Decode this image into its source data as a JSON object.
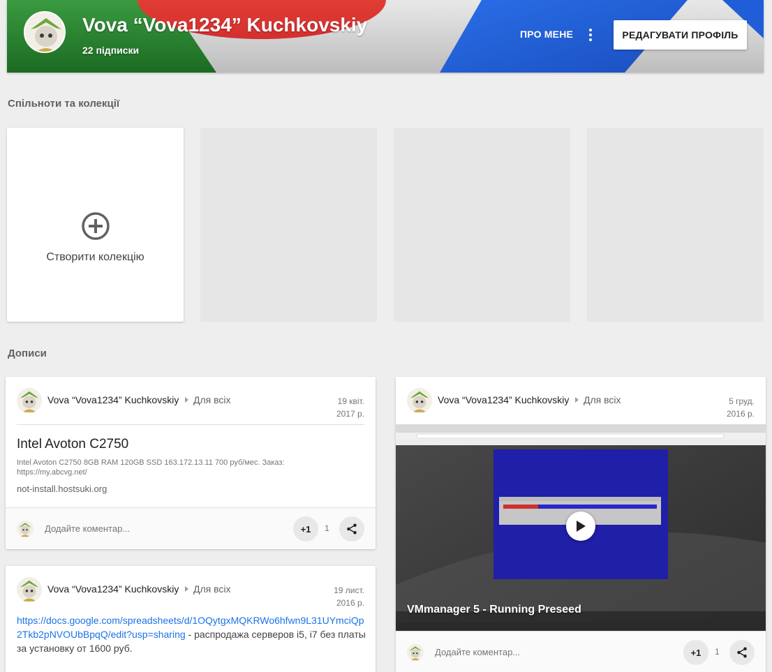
{
  "header": {
    "name": "Vova “Vova1234” Kuchkovskiy",
    "subscriptions": "22 підписки",
    "about_label": "ПРО МЕНЕ",
    "edit_label": "РЕДАГУВАТИ ПРОФІЛЬ",
    "icons": {
      "more": "more-vert-icon",
      "avatar": "avatar"
    }
  },
  "collections": {
    "section_title": "Спільноти та колекції",
    "create_label": "Створити колекцію",
    "create_icon": "add-circle-icon",
    "placeholder_count": 3
  },
  "posts_section": {
    "title": "Дописи"
  },
  "posts": [
    {
      "author": "Vova “Vova1234” Kuchkovskiy",
      "audience": "Для всіх",
      "date_line1": "19 квіт.",
      "date_line2": "2017 р.",
      "link_title": "Intel Avoton C2750",
      "link_description": "Intel Avoton C2750 8GB RAM 120GB SSD 163.172.13.11 700 руб/мес. Заказ: https://my.abcvg.net/",
      "link_domain": "not-install.hostsuki.org",
      "comment_placeholder": "Додайте коментар...",
      "plus_label": "+1",
      "plus_count": "1"
    },
    {
      "author": "Vova “Vova1234” Kuchkovskiy",
      "audience": "Для всіх",
      "date_line1": "5 груд.",
      "date_line2": "2016 р.",
      "video_title": "VMmanager 5 - Running Preseed",
      "comment_placeholder": "Додайте коментар...",
      "plus_label": "+1",
      "plus_count": "1"
    },
    {
      "author": "Vova “Vova1234” Kuchkovskiy",
      "audience": "Для всіх",
      "date_line1": "19 лист.",
      "date_line2": "2016 р.",
      "url": "https://docs.google.com/spreadsheets/d/1OQytgxMQKRWo6hfwn9L31UYmciQp2Tkb2pNVOUbBpqQ/edit?usp=sharing",
      "text_after": " - распродажа серверов i5, i7 без платы за установку от 1600 руб."
    }
  ],
  "colors": {
    "header_green": "#2e7d32",
    "header_red": "#e53935",
    "header_blue": "#1e5fd6",
    "link": "#1a73e8",
    "page_bg": "#eeeeee"
  }
}
